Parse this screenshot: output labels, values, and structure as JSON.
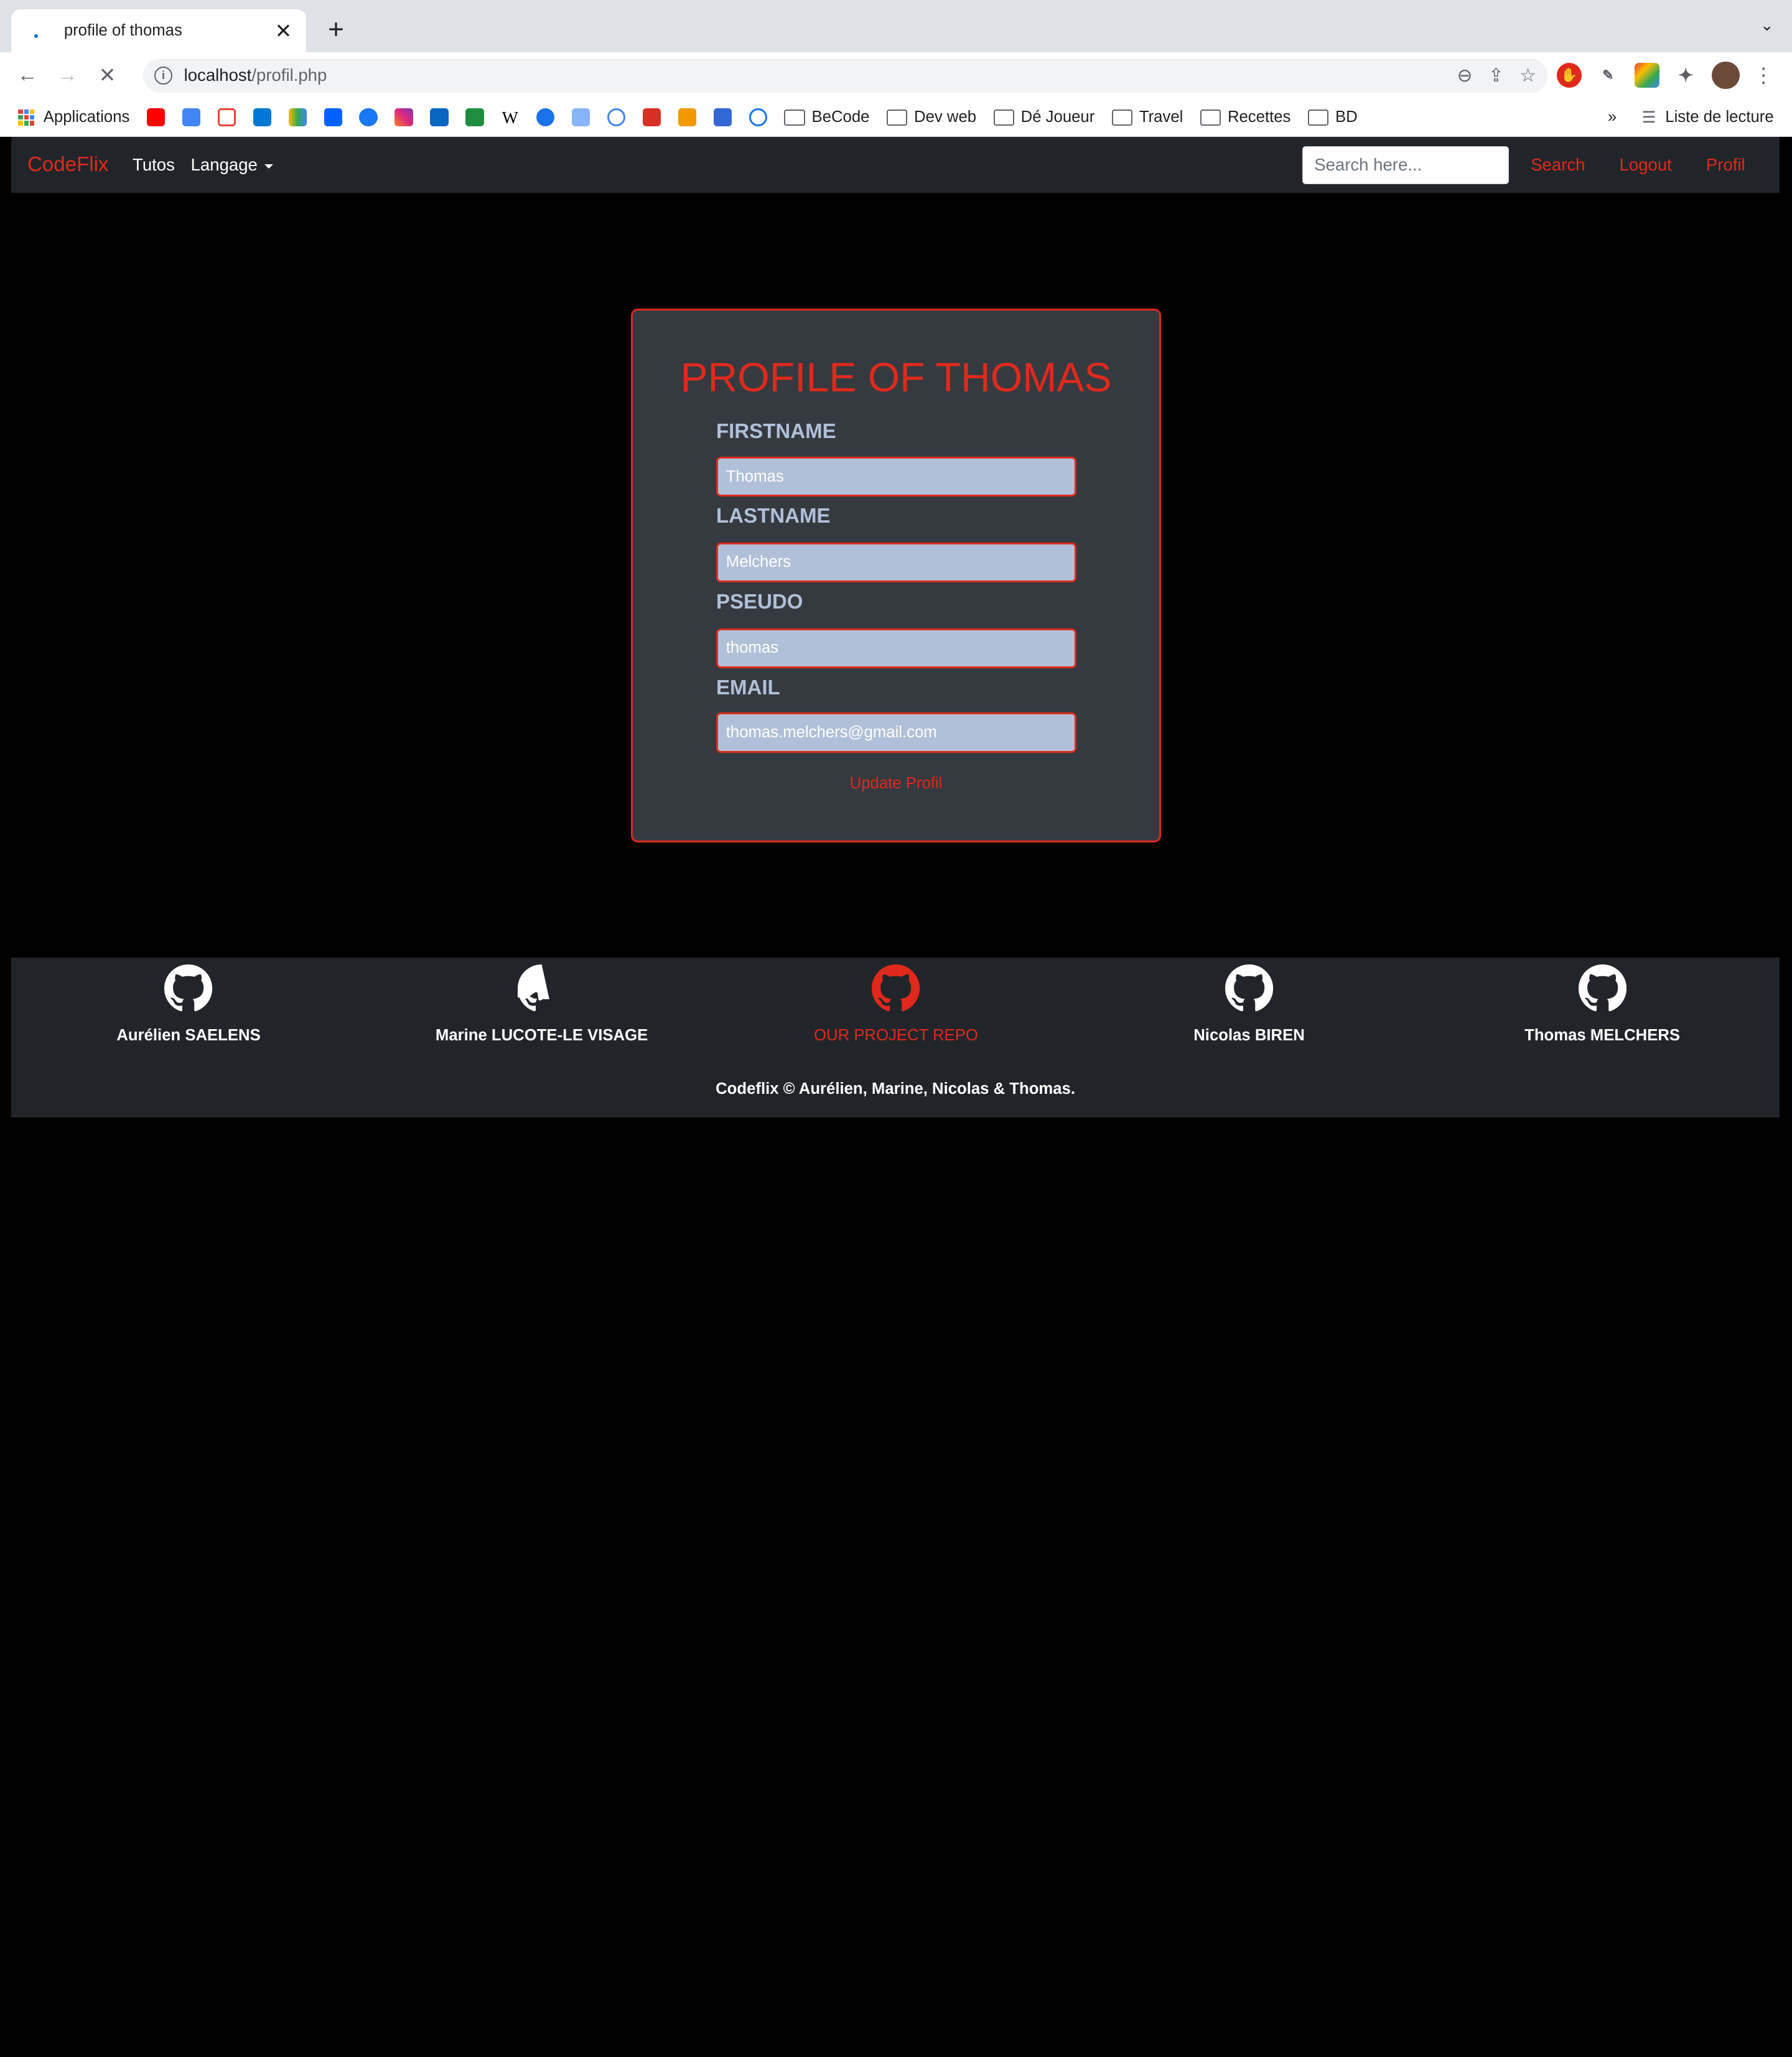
{
  "browser": {
    "tab_title": "profile of thomas",
    "url_host": "localhost",
    "url_path": "/profil.php",
    "bookmarks": {
      "apps": "Applications",
      "folders": [
        "BeCode",
        "Dev web",
        "Dé Joueur",
        "Travel",
        "Recettes",
        "BD"
      ],
      "more": "»",
      "reading_list": "Liste de lecture"
    }
  },
  "navbar": {
    "brand": "CodeFlix",
    "links": [
      "Tutos",
      "Langage"
    ],
    "search_placeholder": "Search here...",
    "search_label": "Search",
    "logout_label": "Logout",
    "profil_label": "Profil"
  },
  "profile": {
    "title": "PROFILE OF THOMAS",
    "fields": [
      {
        "label": "FIRSTNAME",
        "value": "Thomas"
      },
      {
        "label": "LASTNAME",
        "value": "Melchers"
      },
      {
        "label": "PSEUDO",
        "value": "thomas"
      },
      {
        "label": "EMAIL",
        "value": "thomas.melchers@gmail.com"
      }
    ],
    "update_label": "Update Profil"
  },
  "footer": {
    "members": [
      "Aurélien SAELENS",
      "Marine LUCOTE-LE VISAGE",
      "OUR PROJECT REPO",
      "Nicolas BIREN",
      "Thomas MELCHERS"
    ],
    "copyright": "Codeflix © Aurélien, Marine, Nicolas & Thomas."
  },
  "colors": {
    "accent": "#e0291c",
    "panel": "#343a40",
    "navbar": "#212529",
    "input_bg": "#b0c0d8"
  }
}
